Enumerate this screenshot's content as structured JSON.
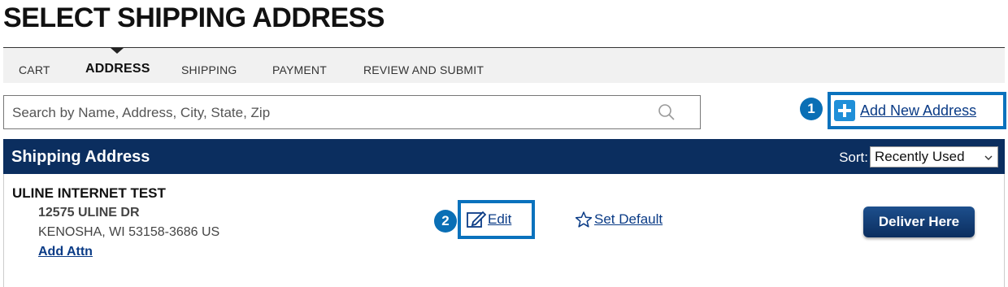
{
  "page": {
    "title": "SELECT SHIPPING ADDRESS"
  },
  "steps": [
    {
      "label": "CART",
      "active": false
    },
    {
      "label": "ADDRESS",
      "active": true
    },
    {
      "label": "SHIPPING",
      "active": false
    },
    {
      "label": "PAYMENT",
      "active": false
    },
    {
      "label": "REVIEW AND SUBMIT",
      "active": false
    }
  ],
  "search": {
    "placeholder": "Search by Name, Address, City, State, Zip",
    "value": "",
    "icon": "search-icon"
  },
  "add_address": {
    "label": "Add New Address",
    "icon": "plus-icon",
    "callout": "1"
  },
  "table": {
    "title": "Shipping Address",
    "sort_label": "Sort:",
    "sort_value": "Recently Used"
  },
  "address": {
    "name": "ULINE INTERNET TEST",
    "line1": "12575 ULINE DR",
    "line2": "KENOSHA, WI 53158-3686 US",
    "attn_link": "Add Attn",
    "edit_label": "Edit",
    "edit_callout": "2",
    "set_default_label": "Set Default",
    "deliver_label": "Deliver Here"
  },
  "colors": {
    "header_bg": "#0b2e5f",
    "callout": "#0a6fb5",
    "link": "#0a3b86",
    "highlight": "#0a72bd"
  }
}
